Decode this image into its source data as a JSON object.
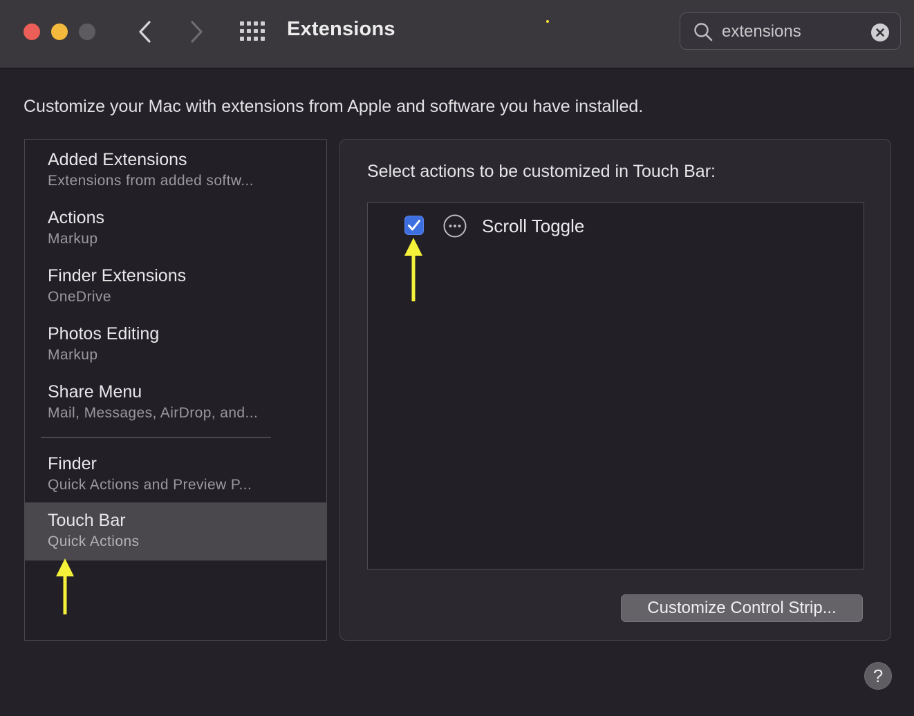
{
  "window": {
    "title": "Extensions"
  },
  "search": {
    "value": "extensions"
  },
  "description": "Customize your Mac with extensions from Apple and software you have installed.",
  "sidebar": {
    "items": [
      {
        "name": "Added Extensions",
        "sub": "Extensions from added softw..."
      },
      {
        "name": "Actions",
        "sub": "Markup"
      },
      {
        "name": "Finder Extensions",
        "sub": "OneDrive"
      },
      {
        "name": "Photos Editing",
        "sub": "Markup"
      },
      {
        "name": "Share Menu",
        "sub": "Mail, Messages, AirDrop, and..."
      },
      {
        "name": "Finder",
        "sub": "Quick Actions and Preview P..."
      },
      {
        "name": "Touch Bar",
        "sub": "Quick Actions"
      }
    ],
    "selected": "Touch Bar"
  },
  "panel": {
    "heading": "Select actions to be customized in Touch Bar:",
    "actions": [
      {
        "label": "Scroll Toggle",
        "checked": true,
        "icon": "ellipsis-circle-icon"
      }
    ],
    "customize_button": "Customize Control Strip..."
  },
  "help_label": "?",
  "colors": {
    "accent": "#3d6fe0",
    "annotation_arrow": "#f5f13a",
    "close": "#ec5e58",
    "minimize": "#f3b93c"
  }
}
